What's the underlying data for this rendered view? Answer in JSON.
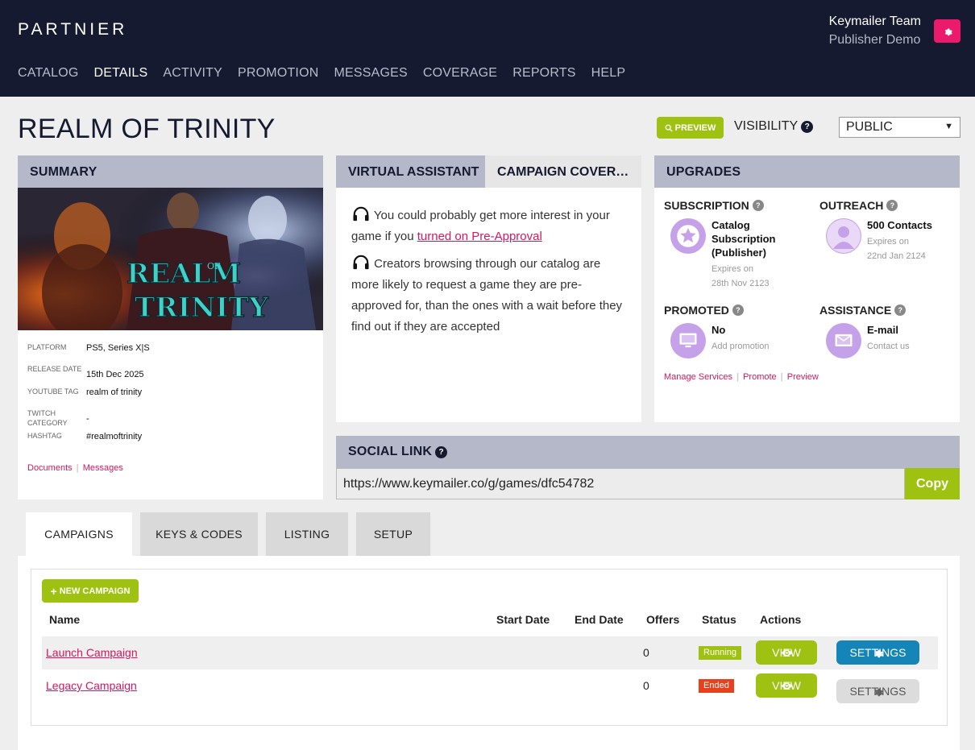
{
  "header": {
    "logo": "PARTNIER",
    "user_name": "Keymailer Team",
    "user_org": "Publisher Demo",
    "nav": [
      "CATALOG",
      "DETAILS",
      "ACTIVITY",
      "PROMOTION",
      "MESSAGES",
      "COVERAGE",
      "REPORTS",
      "HELP"
    ],
    "active_nav": "DETAILS",
    "accent": "#ec1a6b"
  },
  "page": {
    "title": "REALM OF TRINITY",
    "preview_label": "PREVIEW",
    "visibility_label": "VISIBILITY",
    "visibility_value": "PUBLIC"
  },
  "summary": {
    "heading": "SUMMARY",
    "hero_logo_text": "REALM OF TRINITY",
    "fields": [
      {
        "label": "PLATFORM",
        "value": "PS5, Series X|S"
      },
      {
        "label": "RELEASE DATE",
        "value": "15th Dec 2025"
      },
      {
        "label": "YOUTUBE TAG",
        "value": "realm of trinity"
      },
      {
        "label": "TWITCH CATEGORY",
        "value": "-"
      },
      {
        "label": "HASHTAG",
        "value": "#realmoftrinity"
      }
    ],
    "links": [
      "Documents",
      "Messages"
    ]
  },
  "assistant": {
    "tab_active": "VIRTUAL ASSISTANT",
    "tab_other": "CAMPAIGN COVER…",
    "msg1_pre": "You could probably get more interest in your game if you ",
    "msg1_link": "turned on Pre-Approval",
    "msg2": "Creators browsing through our catalog are more likely to request a game they are pre-approved for, than the ones with a wait before they find out if they are accepted"
  },
  "upgrades": {
    "heading": "UPGRADES",
    "items": [
      {
        "title": "SUBSCRIPTION",
        "value": "Catalog Subscription (Publisher)",
        "sub1": "Expires on",
        "sub2": "28th Nov 2123",
        "icon": "star-icon"
      },
      {
        "title": "OUTREACH",
        "value": "500 Contacts",
        "sub1": "Expires on",
        "sub2": "22nd Jan 2124",
        "icon": "person-icon"
      },
      {
        "title": "PROMOTED",
        "value": "No",
        "sub1": "Add promotion",
        "icon": "monitor-icon"
      },
      {
        "title": "ASSISTANCE",
        "value": "E-mail",
        "sub1": "Contact us",
        "icon": "email-icon"
      }
    ],
    "links": [
      "Manage Services",
      "Promote",
      "Preview"
    ]
  },
  "social": {
    "heading": "SOCIAL LINK",
    "url": "https://www.keymailer.co/g/games/dfc54782",
    "copy_label": "Copy"
  },
  "campaign_tabs": [
    "CAMPAIGNS",
    "KEYS & CODES",
    "LISTING",
    "SETUP"
  ],
  "campaigns": {
    "new_label": "NEW CAMPAIGN",
    "columns": [
      "Name",
      "Start Date",
      "End Date",
      "Offers",
      "Status",
      "Actions"
    ],
    "rows": [
      {
        "name": "Launch Campaign",
        "start": "",
        "end": "",
        "offers": "0",
        "status": "Running",
        "view": "VIEW",
        "settings": "SETTINGS"
      },
      {
        "name": "Legacy Campaign",
        "start": "",
        "end": "",
        "offers": "0",
        "status": "Ended",
        "view": "VIEW",
        "settings": "SETTINGS"
      }
    ]
  }
}
